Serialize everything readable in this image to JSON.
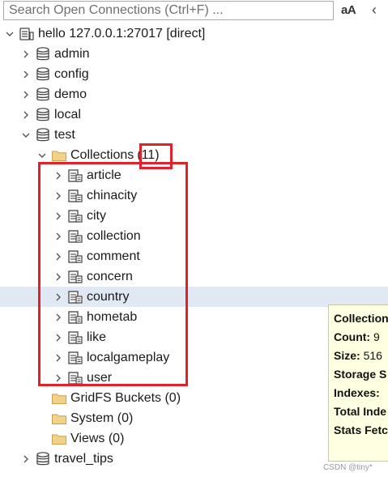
{
  "search": {
    "placeholder": "Search Open Connections (Ctrl+F) ..."
  },
  "toolbar": {
    "case_toggle": "aA",
    "collapse": "‹"
  },
  "tree": {
    "connection": "hello 127.0.0.1:27017 [direct]",
    "databases": [
      "admin",
      "config",
      "demo",
      "local",
      "test"
    ],
    "collections_folder": "Collections",
    "collections_count": "(11)",
    "collections": [
      "article",
      "chinacity",
      "city",
      "collection",
      "comment",
      "concern",
      "country",
      "hometab",
      "like",
      "localgameplay",
      "user"
    ],
    "gridfs": "GridFS Buckets (0)",
    "system": "System (0)",
    "views": "Views (0)",
    "last_database": "travel_tips",
    "selected_collection": "country"
  },
  "tooltip": {
    "lines": [
      {
        "label": "Collection",
        "value": ""
      },
      {
        "label": "Count:",
        "value": " 9"
      },
      {
        "label": "Size:",
        "value": " 516"
      },
      {
        "label": "Storage S",
        "value": ""
      },
      {
        "label": "Indexes:",
        "value": ""
      },
      {
        "label": "Total Inde",
        "value": ""
      },
      {
        "label": "Stats Fetc",
        "value": ""
      }
    ]
  },
  "watermark": "CSDN @tiny*",
  "colors": {
    "highlight": "#e0202b",
    "selection": "#dfe8f3",
    "tooltip_bg": "#ffffe1",
    "folder": "#f2d289"
  }
}
